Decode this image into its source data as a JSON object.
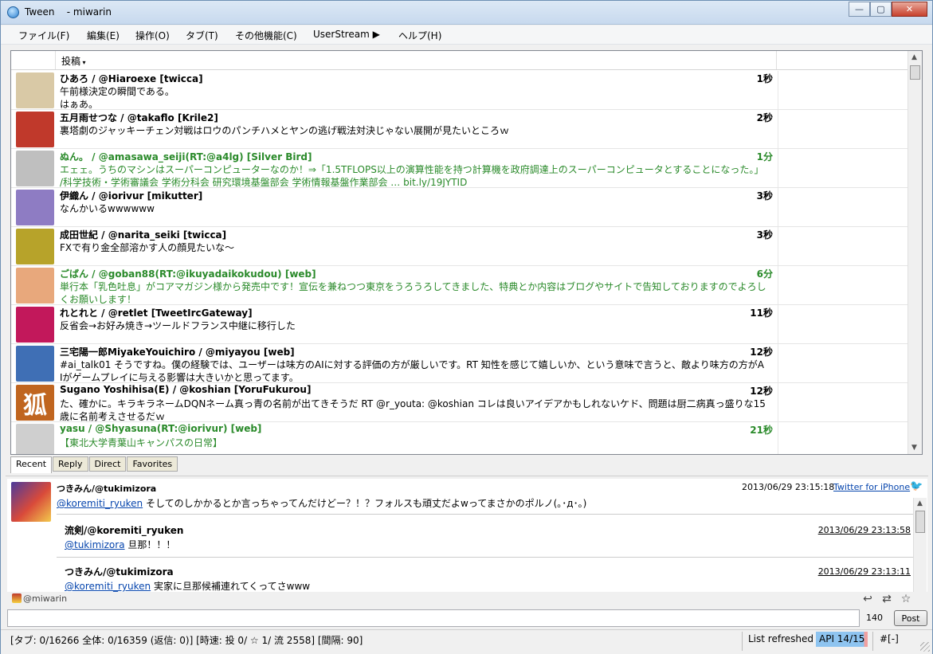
{
  "window": {
    "app_name": "Tween",
    "title": "Tween    - miwarin",
    "minimize": "—",
    "maximize": "▢",
    "close": "✕"
  },
  "menu": [
    {
      "label": "ファイル(F)"
    },
    {
      "label": "編集(E)"
    },
    {
      "label": "操作(O)"
    },
    {
      "label": "タブ(T)"
    },
    {
      "label": "その他機能(C)"
    },
    {
      "label": "UserStream ▶"
    },
    {
      "label": "ヘルプ(H)"
    }
  ],
  "timeline": {
    "column_header": "投稿",
    "rows": [
      {
        "head": "ひあろ / @Hiaroexe [twicca]",
        "time": "1秒",
        "body": "午前様決定の瞬間である。\nはぁあ。",
        "rt": false,
        "avatar_color": "#d9c9a6"
      },
      {
        "head": "五月雨せつな / @takaflo [Krile2]",
        "time": "2秒",
        "body": "裏塔劇のジャッキーチェン対戦はロウのパンチハメとヤンの逃げ戦法対決じゃない展開が見たいところｗ",
        "rt": false,
        "avatar_color": "#c0392b"
      },
      {
        "head": "ぬん。 / @amasawa_seiji(RT:@a4lg) [Silver Bird]",
        "time": "1分",
        "body": "エェェ。うちのマシンはスーパーコンピューターなのか！⇒「1.5TFLOPS以上の演算性能を持つ計算機を政府調達上のスーパーコンピュータとすることになった。」\n/科学技術・学術審議会 学術分科会 研究環境基盤部会 学術情報基盤作業部会 … bit.ly/19JYTID",
        "rt": true,
        "avatar_color": "#bfbfbf"
      },
      {
        "head": "伊織ん / @iorivur [mikutter]",
        "time": "3秒",
        "body": "なんかいるwwwwww",
        "rt": false,
        "avatar_color": "#8e7cc3"
      },
      {
        "head": "成田世紀 / @narita_seiki [twicca]",
        "time": "3秒",
        "body": "FXで有り金全部溶かす人の顔見たいな〜",
        "rt": false,
        "avatar_color": "#b7a32a"
      },
      {
        "head": "ごばん / @goban88(RT:@ikuyadaikokudou) [web]",
        "time": "6分",
        "body": "単行本「乳色吐息」がコアマガジン様から発売中です！宣伝を兼ねつつ東京をうろうろしてきました、特典とか内容はブログやサイトで告知しておりますのでよろし\nくお願いします！",
        "rt": true,
        "avatar_color": "#e8a87c"
      },
      {
        "head": "れとれと / @retlet [TweetIrcGateway]",
        "time": "11秒",
        "body": "反省会→お好み焼き→ツールドフランス中継に移行した",
        "rt": false,
        "avatar_color": "#c2185b"
      },
      {
        "head": "三宅陽一郎MiyakeYouichiro / @miyayou [web]",
        "time": "12秒",
        "body": "#ai_talk01 そうですね。僕の経験では、ユーザーは味方のAIに対する評価の方が厳しいです。RT 知性を感じて嬉しいか、という意味で言うと、敵より味方の方がA\nIがゲームプレイに与える影響は大きいかと思ってます。",
        "rt": false,
        "avatar_color": "#3f6fb5"
      },
      {
        "head": "Sugano Yoshihisa(E) / @koshian [YoruFukurou]",
        "time": "12秒",
        "body": "た、確かに。キラキラネームDQNネーム真っ青の名前が出てきそうだ RT @r_youta: @koshian コレは良いアイデアかもしれないケド、問題は厨二病真っ盛りな15\n歳に名前考えさせるだｗ",
        "rt": false,
        "avatar_color": "#c0651f",
        "avatar_char": "狐"
      },
      {
        "head": "yasu / @Shyasuna(RT:@iorivur) [web]",
        "time": "21秒",
        "body": "【東北大学青葉山キャンパスの日常】",
        "rt": true,
        "avatar_color": "#cfcfcf"
      }
    ]
  },
  "tabs": [
    {
      "label": "Recent",
      "active": true
    },
    {
      "label": "Reply",
      "active": false
    },
    {
      "label": "Direct",
      "active": false
    },
    {
      "label": "Favorites",
      "active": false
    }
  ],
  "detail": {
    "name": "つきみん/@tukimizora",
    "date": "2013/06/29 23:15:18",
    "source": "Twitter for iPhone",
    "mention": "@koremiti_ryuken",
    "text": " そしてのしかかるとか言っちゃってんだけどー？！？フォルスも頑丈だよwってまさかのポルノ(｡･д･｡)",
    "replies": [
      {
        "name": "流剣/@koremiti_ryuken",
        "date": "2013/06/29 23:13:58",
        "mention": "@tukimizora",
        "text": " 旦那！！！"
      },
      {
        "name": "つきみん/@tukimizora",
        "date": "2013/06/29 23:13:11",
        "mention": "@koremiti_ryuken",
        "text": " 実家に旦那候補連れてくってさwww"
      }
    ]
  },
  "composer": {
    "account": "@miwarin",
    "value": "",
    "counter": "140",
    "post_label": "Post"
  },
  "statusbar": {
    "main": "[タブ: 0/16266 全体: 0/16359 (返信: 0)] [時速: 投 0/ ☆ 1/ 流 2558] [間隔: 90]",
    "list": "List refreshed",
    "api": "API 14/15",
    "hash": "#[-]"
  }
}
